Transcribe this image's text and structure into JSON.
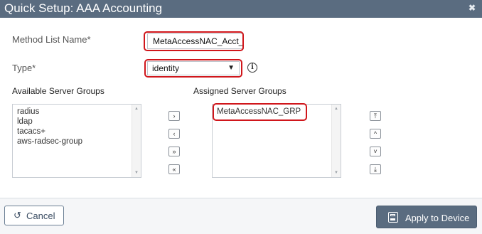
{
  "window": {
    "title": "Quick Setup: AAA Accounting",
    "close_icon": "close-icon"
  },
  "form": {
    "method_list_label": "Method List Name*",
    "method_list_value": "MetaAccessNAC_Acct_L",
    "type_label": "Type*",
    "type_value": "identity",
    "info_icon_glyph": "i"
  },
  "available": {
    "label": "Available Server Groups",
    "items": [
      "radius",
      "ldap",
      "tacacs+",
      "aws-radsec-group"
    ]
  },
  "assigned": {
    "label": "Assigned Server Groups",
    "items": [
      "MetaAccessNAC_GRP"
    ]
  },
  "transfer_buttons": {
    "move_right": "›",
    "move_left": "‹",
    "move_all_right": "»",
    "move_all_left": "«"
  },
  "order_buttons": {
    "top": "⤒",
    "up": "^",
    "down": "˅",
    "bottom": "⤓"
  },
  "footer": {
    "cancel_label": "Cancel",
    "apply_label": "Apply to Device"
  },
  "colors": {
    "header": "#5a6c80",
    "highlight": "#d0161b",
    "apply_button": "#5a6c80"
  }
}
